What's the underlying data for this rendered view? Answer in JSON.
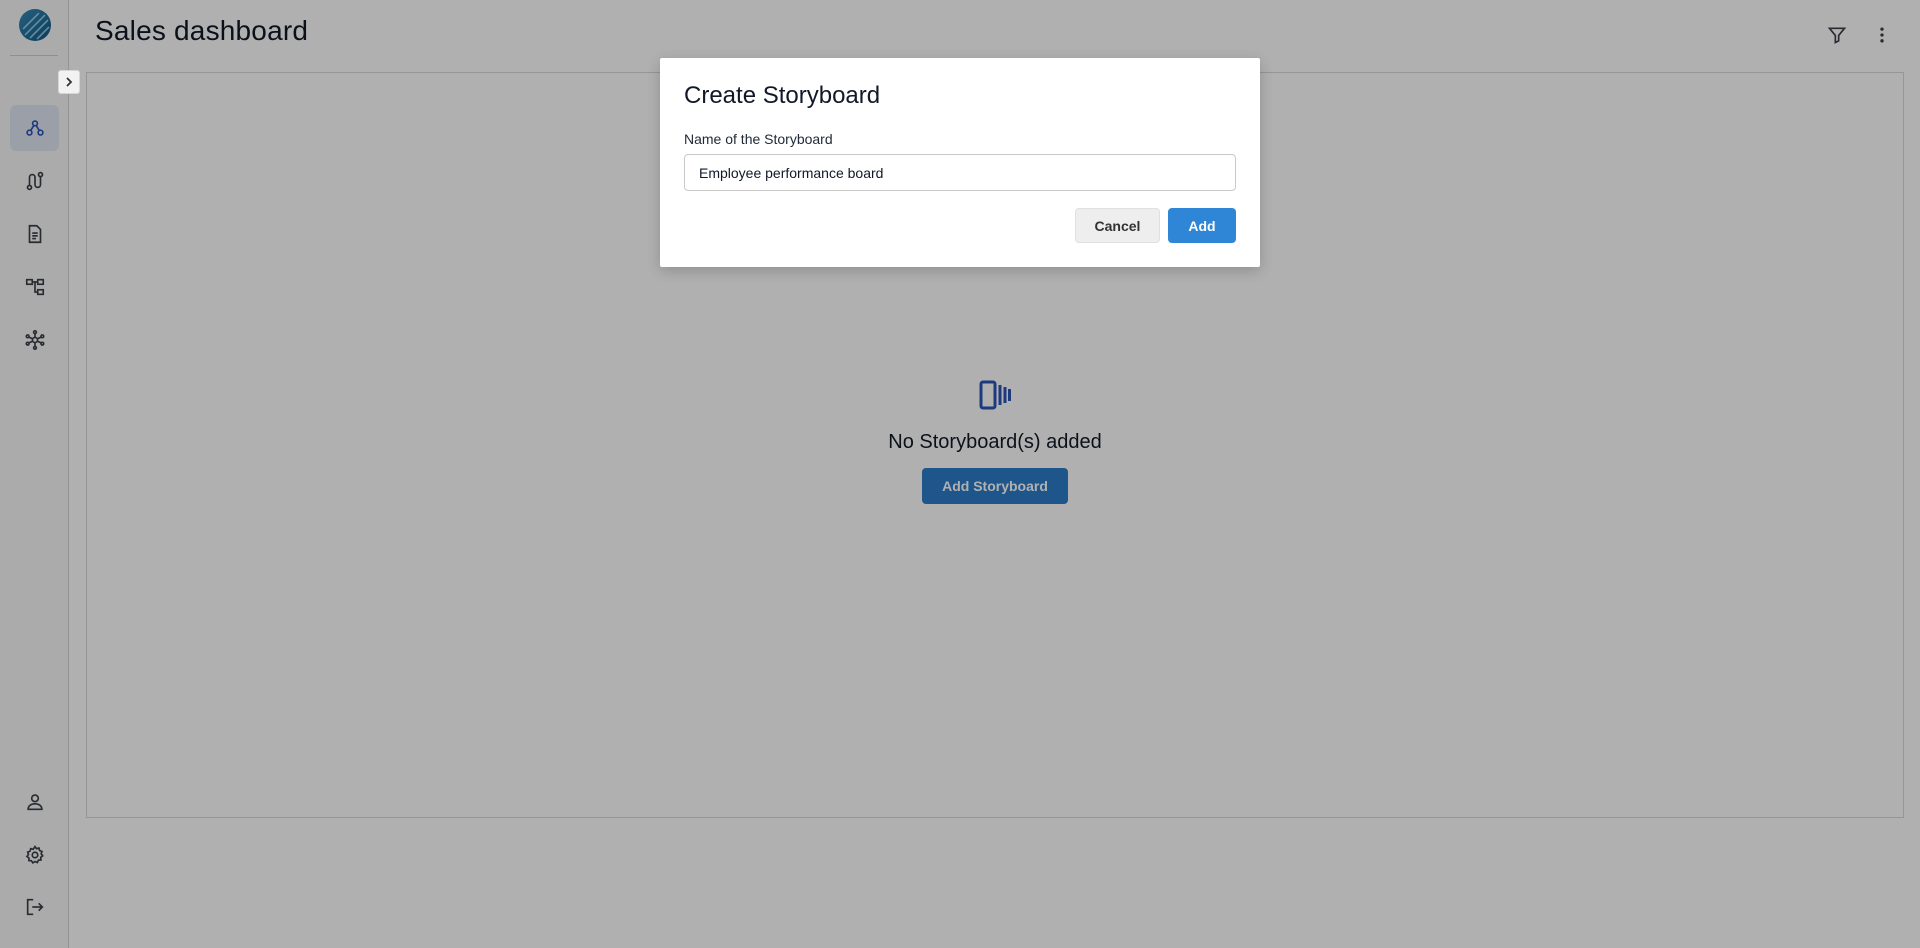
{
  "page": {
    "title": "Sales dashboard"
  },
  "sidebar": {
    "items": [
      {
        "icon": "hierarchy-nodes-icon",
        "active": true
      },
      {
        "icon": "workflow-icon",
        "active": false
      },
      {
        "icon": "document-icon",
        "active": false
      },
      {
        "icon": "tree-structure-icon",
        "active": false
      },
      {
        "icon": "network-hub-icon",
        "active": false
      }
    ],
    "bottom_items": [
      {
        "icon": "user-icon"
      },
      {
        "icon": "gear-icon"
      },
      {
        "icon": "logout-icon"
      }
    ]
  },
  "header": {
    "actions": [
      {
        "icon": "filter-icon"
      },
      {
        "icon": "more-vertical-icon"
      }
    ]
  },
  "empty_state": {
    "icon": "storyboard-icon",
    "message": "No Storyboard(s) added",
    "button_label": "Add Storyboard"
  },
  "dialog": {
    "title": "Create Storyboard",
    "field_label": "Name of the Storyboard",
    "field_value": "Employee performance board",
    "cancel_label": "Cancel",
    "add_label": "Add"
  },
  "colors": {
    "primary": "#2f86d6",
    "sidebar_active_bg": "#e1e6f4",
    "icon_blue": "#2c55b8",
    "overlay": "rgba(0,0,0,0.31)"
  }
}
